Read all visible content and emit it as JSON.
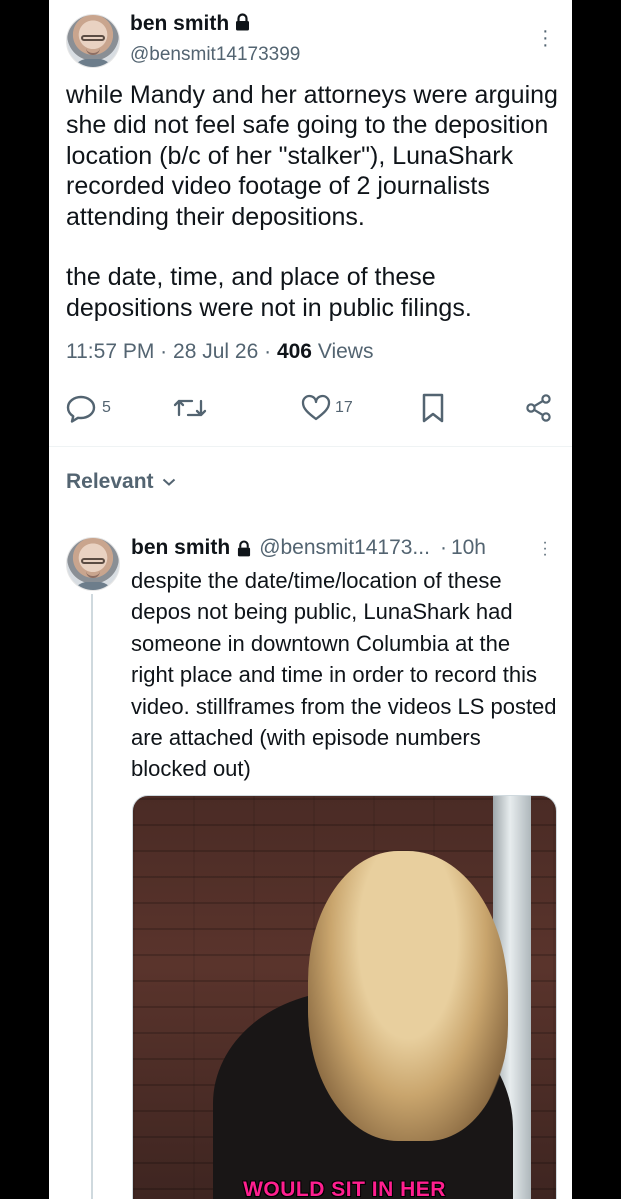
{
  "tweet": {
    "author_name": "ben smith",
    "handle": "@bensmit14173399",
    "text": "while Mandy and her attorneys were arguing she did not feel safe going to the deposition location (b/c of her \"stalker\"), LunaShark recorded video footage of 2 journalists attending their depositions.\n\nthe date, time, and place of these depositions were not in public filings.",
    "time": "11:57 PM",
    "date": "28 Jul 26",
    "views_count": "406",
    "views_label": "Views",
    "meta_separator": "·",
    "replies": "5",
    "likes": "17"
  },
  "filter": {
    "label": "Relevant"
  },
  "reply": {
    "author_name": "ben smith",
    "handle": "@bensmit14173...",
    "separator": "·",
    "age": "10h",
    "text": "despite the date/time/location of these depos not being public, LunaShark had someone in downtown Columbia at the right place and time in order to record this video. stillframes from the videos LS posted are attached (with episode numbers blocked out)",
    "media_caption": "WOULD SIT IN HER"
  },
  "colors": {
    "text_primary": "#0f1419",
    "text_secondary": "#536471",
    "caption": "#ff1f8f"
  },
  "icons": [
    "lock-icon",
    "more-icon",
    "reply-icon",
    "retweet-icon",
    "like-icon",
    "bookmark-icon",
    "share-icon",
    "chevron-down-icon"
  ]
}
